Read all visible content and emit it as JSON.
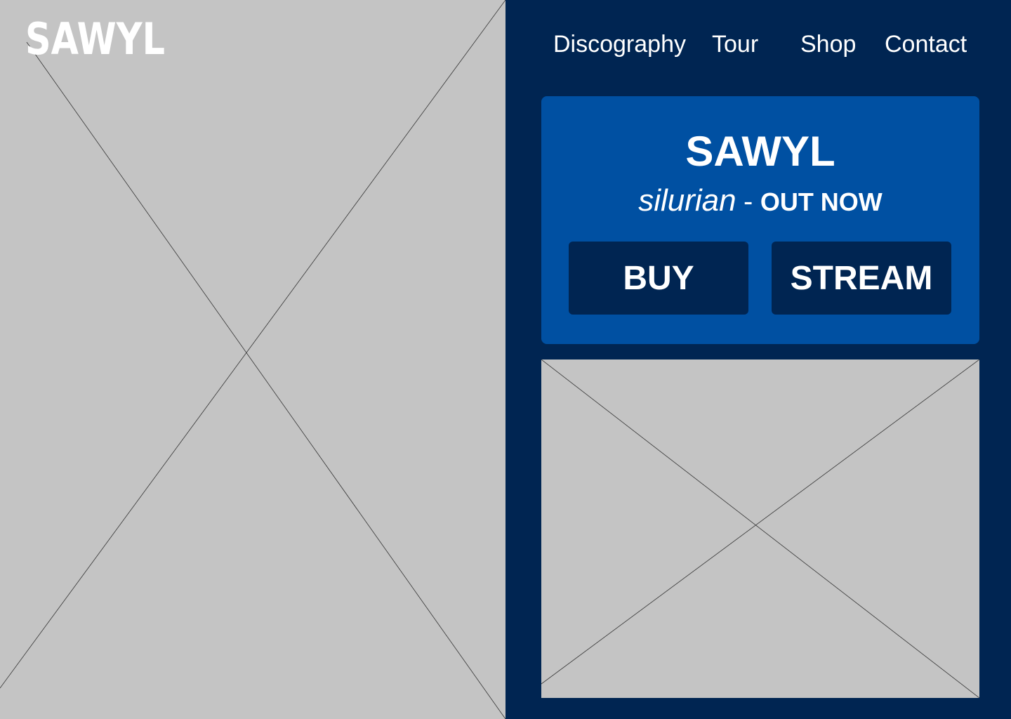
{
  "header": {
    "logo_text": "SAWYL"
  },
  "nav": {
    "items": [
      {
        "label": "Discography"
      },
      {
        "label": "Tour"
      },
      {
        "label": "Shop"
      },
      {
        "label": "Contact"
      }
    ]
  },
  "release": {
    "artist": "SAWYL",
    "title": "silurian",
    "separator": "-",
    "status": "OUT NOW",
    "buy_label": "BUY",
    "stream_label": "STREAM"
  },
  "colors": {
    "page_background": "#002552",
    "card_background": "#0050A2",
    "button_background": "#002552",
    "placeholder_gray": "#C4C4C4",
    "text": "#FFFFFF"
  },
  "icons": {
    "hero_placeholder": "image-placeholder-icon",
    "feature_placeholder": "image-placeholder-icon"
  }
}
